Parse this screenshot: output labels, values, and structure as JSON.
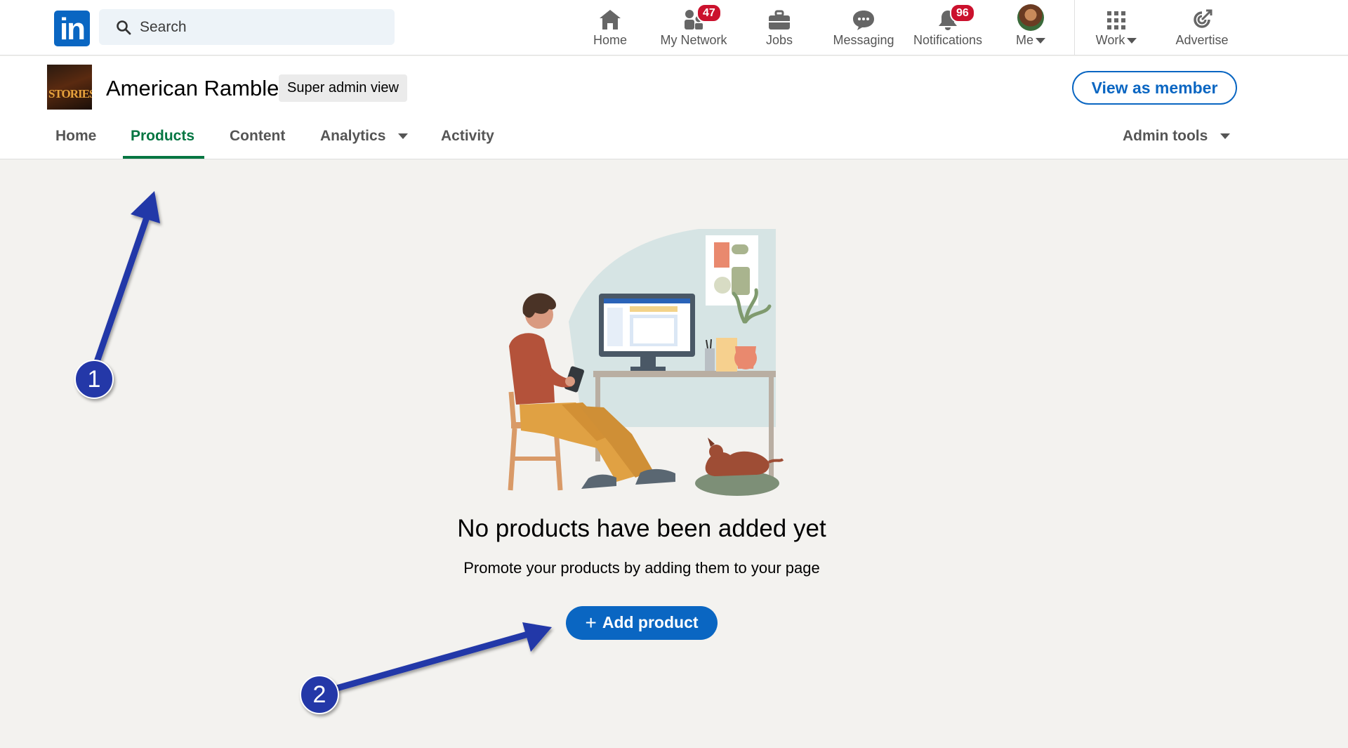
{
  "nav": {
    "logo": "in",
    "search_placeholder": "Search",
    "items": [
      {
        "label": "Home"
      },
      {
        "label": "My Network",
        "badge": "47"
      },
      {
        "label": "Jobs"
      },
      {
        "label": "Messaging"
      },
      {
        "label": "Notifications",
        "badge": "96"
      },
      {
        "label": "Me"
      },
      {
        "label": "Work"
      },
      {
        "label": "Advertise"
      }
    ]
  },
  "company": {
    "name": "American Ramble",
    "logo_text": "STORIES",
    "admin_badge": "Super admin view",
    "view_as_member": "View as member"
  },
  "tabs": [
    {
      "label": "Home"
    },
    {
      "label": "Products",
      "active": true
    },
    {
      "label": "Content"
    },
    {
      "label": "Analytics"
    },
    {
      "label": "Activity"
    },
    {
      "label": "Admin tools"
    }
  ],
  "empty_state": {
    "title": "No products have been added yet",
    "subtitle": "Promote your products by adding them to your page",
    "add_button": "Add product"
  },
  "annotations": {
    "step1": "1",
    "step2": "2"
  },
  "colors": {
    "brand_blue": "#0a66c2",
    "active_tab_green": "#057642",
    "badge_red": "#cb112d",
    "annotation_blue": "#2438a8",
    "page_bg": "#f3f2ef"
  }
}
